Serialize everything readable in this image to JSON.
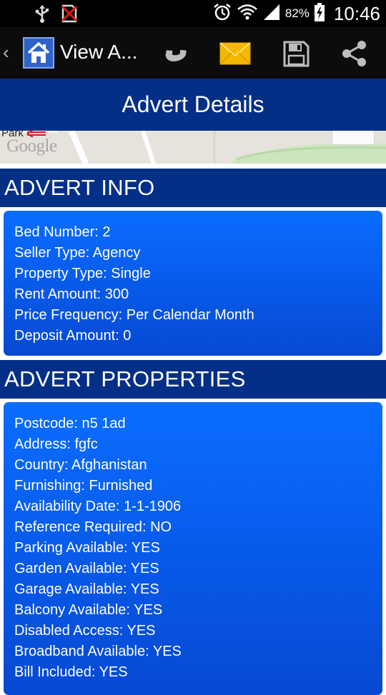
{
  "status_bar": {
    "battery": "82%",
    "time": "10:46"
  },
  "action_bar": {
    "title": "View A..."
  },
  "page_title": "Advert Details",
  "map": {
    "place_label": "Park",
    "attribution": "Google"
  },
  "advert_info": {
    "heading": "ADVERT INFO",
    "rows": [
      "Bed Number: 2",
      "Seller Type: Agency",
      "Property Type: Single",
      "Rent Amount: 300",
      "Price Frequency: Per Calendar Month",
      "Deposit Amount: 0"
    ]
  },
  "advert_properties": {
    "heading": "ADVERT PROPERTIES",
    "rows": [
      "Postcode: n5 1ad",
      "Address: fgfc",
      "Country: Afghanistan",
      "Furnishing: Furnished",
      "Availability Date: 1-1-1906",
      "Reference Required: NO",
      "Parking Available: YES",
      "Garden Available: YES",
      "Garage Available: YES",
      "Balcony Available: YES",
      "Disabled Access: YES",
      "Broadband Available: YES",
      "Bill Included: YES"
    ]
  },
  "icons": {
    "status_left": [
      "usb-icon",
      "no-sim-icon"
    ],
    "status_right": [
      "alarm-icon",
      "wifi-icon",
      "signal-icon",
      "battery-charging-icon"
    ],
    "actions": [
      "phone-icon",
      "email-icon",
      "save-icon",
      "share-icon"
    ]
  },
  "colors": {
    "header_band": "#032f86",
    "card_blue": "#0859e8",
    "action_bar": "#0c0c0c"
  }
}
